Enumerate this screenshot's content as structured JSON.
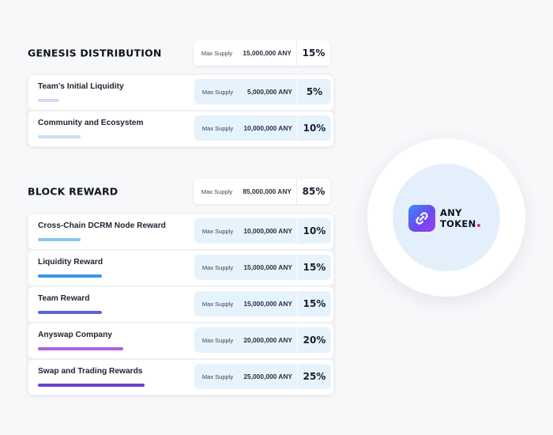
{
  "genesis": {
    "title": "GENESIS DISTRIBUTION",
    "label": "Max Supply",
    "amount": "15,000,000 ANY",
    "percent": "15%",
    "rows": [
      {
        "label": "Team's Initial Liquidity",
        "pill_label": "Max Supply",
        "amount": "5,000,000 ANY",
        "percent": "5%",
        "bar_color": "#e3d2f6",
        "bar_fraction": 0.05
      },
      {
        "label": "Community and Ecosystem",
        "pill_label": "Max Supply",
        "amount": "10,000,000 ANY",
        "percent": "10%",
        "bar_color": "#c9def1",
        "bar_fraction": 0.1
      }
    ]
  },
  "block": {
    "title": "BLOCK REWARD",
    "label": "Max Supply",
    "amount": "85,000,000 ANY",
    "percent": "85%",
    "rows": [
      {
        "label": "Cross-Chain DCRM Node Reward",
        "pill_label": "Max Supply",
        "amount": "10,000,000 ANY",
        "percent": "10%",
        "bar_color": "#8cc4ea",
        "bar_fraction": 0.1
      },
      {
        "label": "Liquidity Reward",
        "pill_label": "Max Supply",
        "amount": "15,000,000 ANY",
        "percent": "15%",
        "bar_color": "#3e94e2",
        "bar_fraction": 0.15
      },
      {
        "label": "Team Reward",
        "pill_label": "Max Supply",
        "amount": "15,000,000 ANY",
        "percent": "15%",
        "bar_color": "#5b63e0",
        "bar_fraction": 0.15
      },
      {
        "label": "Anyswap Company",
        "pill_label": "Max Supply",
        "amount": "20,000,000 ANY",
        "percent": "20%",
        "bar_color": "#b25de2",
        "bar_fraction": 0.2
      },
      {
        "label": "Swap and Trading Rewards",
        "pill_label": "Max Supply",
        "amount": "25,000,000 ANY",
        "percent": "25%",
        "bar_color": "#6d40cf",
        "bar_fraction": 0.25
      }
    ]
  },
  "logo": {
    "line1": "ANY",
    "line2": "TOKEN",
    "dot_color": "#ec2a7a",
    "icon": "link-icon"
  }
}
